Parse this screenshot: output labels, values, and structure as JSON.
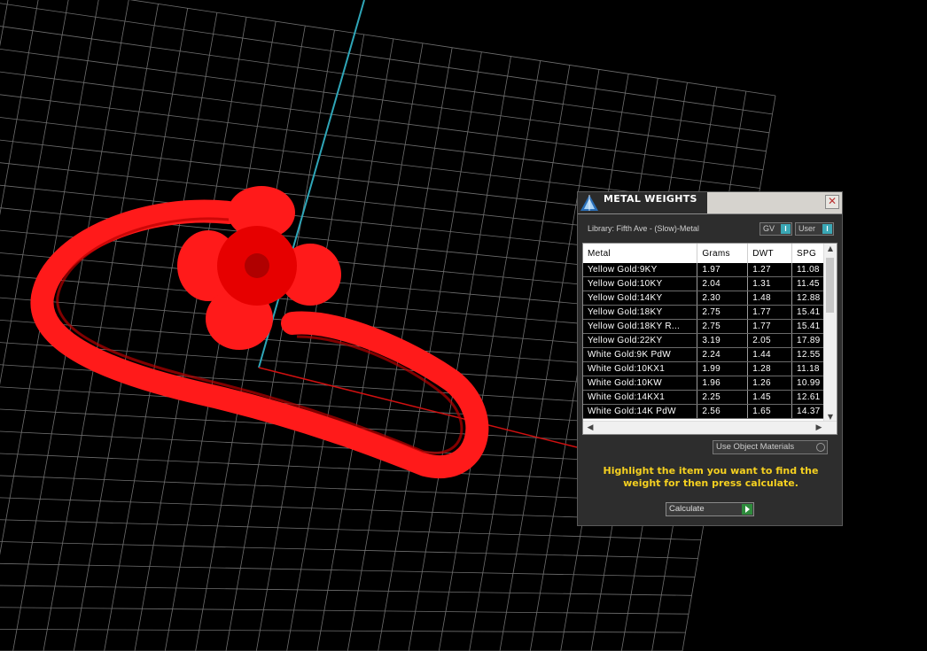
{
  "viewport": {
    "background": "#000000",
    "grid_color": "#6f6f6f",
    "axis_y_color": "#2fa6b8",
    "axis_x_color": "#d01010",
    "model_color": "#ff1a1a"
  },
  "panel": {
    "title": "METAL WEIGHTS",
    "close_label": "✕",
    "library_label": "Library: Fifth Ave - (Slow)-Metal",
    "toggle_gv": "GV",
    "toggle_user": "User",
    "toggle_indicator": "I",
    "table": {
      "headers": [
        "Metal",
        "Grams",
        "DWT",
        "SPG"
      ],
      "rows": [
        [
          "Yellow Gold:9KY",
          "1.97",
          "1.27",
          "11.08"
        ],
        [
          "Yellow Gold:10KY",
          "2.04",
          "1.31",
          "11.45"
        ],
        [
          "Yellow Gold:14KY",
          "2.30",
          "1.48",
          "12.88"
        ],
        [
          "Yellow Gold:18KY",
          "2.75",
          "1.77",
          "15.41"
        ],
        [
          "Yellow Gold:18KY R...",
          "2.75",
          "1.77",
          "15.41"
        ],
        [
          "Yellow Gold:22KY",
          "3.19",
          "2.05",
          "17.89"
        ],
        [
          "White Gold:9K PdW",
          "2.24",
          "1.44",
          "12.55"
        ],
        [
          "White Gold:10KX1",
          "1.99",
          "1.28",
          "11.18"
        ],
        [
          "White Gold:10KW",
          "1.96",
          "1.26",
          "10.99"
        ],
        [
          "White Gold:14KX1",
          "2.25",
          "1.45",
          "12.61"
        ],
        [
          "White Gold:14K PdW",
          "2.56",
          "1.65",
          "14.37"
        ]
      ]
    },
    "use_materials_label": "Use Object Materials",
    "hint": "Highlight the item you want to find the weight for then press calculate.",
    "calculate_label": "Calculate"
  }
}
